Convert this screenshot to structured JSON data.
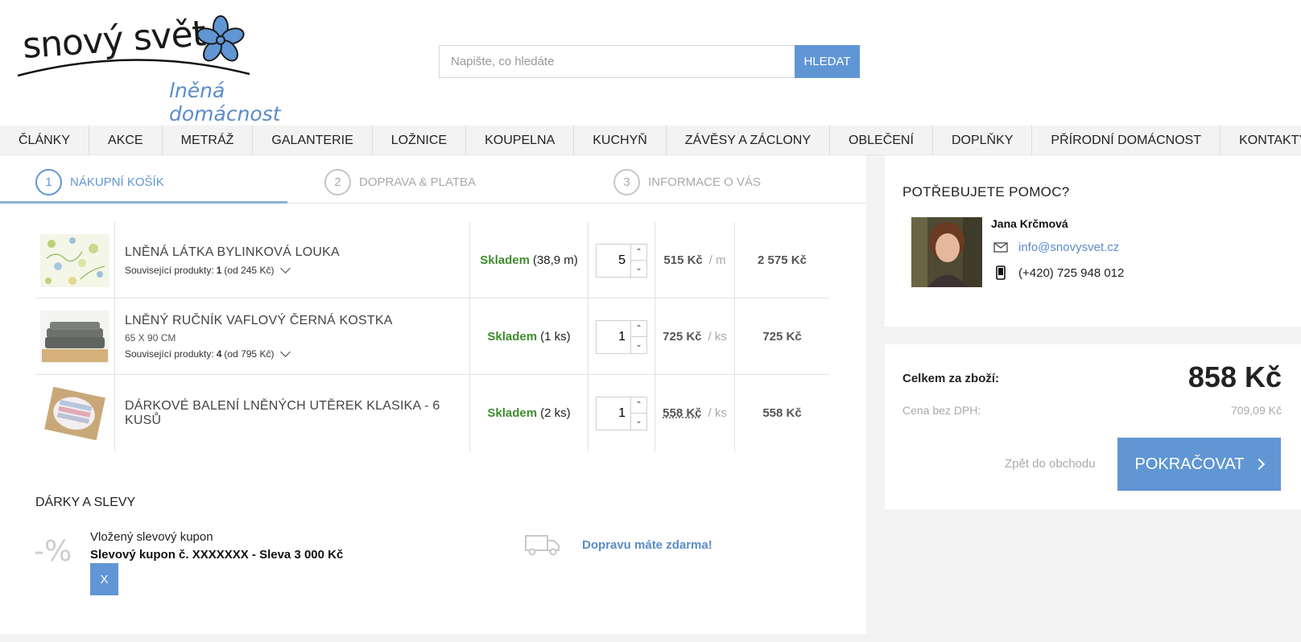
{
  "logo": {
    "main": "snový svět",
    "sub": "lněná domácnost"
  },
  "search": {
    "placeholder": "Napište, co hledáte",
    "button": "HLEDAT"
  },
  "nav": [
    "ČLÁNKY",
    "AKCE",
    "METRÁŽ",
    "GALANTERIE",
    "LOŽNICE",
    "KOUPELNA",
    "KUCHYŇ",
    "ZÁVĚSY A ZÁCLONY",
    "OBLEČENÍ",
    "DOPLŇKY",
    "PŘÍRODNÍ DOMÁCNOST",
    "KONTAKTY"
  ],
  "steps": [
    {
      "num": "1",
      "label": "NÁKUPNÍ KOŠÍK"
    },
    {
      "num": "2",
      "label": "DOPRAVA & PLATBA"
    },
    {
      "num": "3",
      "label": "INFORMACE O VÁS"
    }
  ],
  "cart": {
    "items": [
      {
        "name": "LNĚNÁ LÁTKA BYLINKOVÁ LOUKA",
        "sub": "",
        "related_label": "Související produkty:",
        "related_count": "1",
        "related_from": "(od 245 Kč)",
        "stock": "Skladem",
        "stock_qty": "(38,9 m)",
        "qty": "5",
        "unit_price": "515 Kč",
        "unit": "/ m",
        "total": "2 575 Kč"
      },
      {
        "name": "LNĚNÝ RUČNÍK VAFLOVÝ ČERNÁ KOSTKA",
        "sub": "65 X 90 CM",
        "related_label": "Související produkty:",
        "related_count": "4",
        "related_from": "(od 795 Kč)",
        "stock": "Skladem",
        "stock_qty": "(1 ks)",
        "qty": "1",
        "unit_price": "725 Kč",
        "unit": "/ ks",
        "total": "725 Kč"
      },
      {
        "name": "DÁRKOVÉ BALENÍ LNĚNÝCH UTĚREK KLASIKA - 6 KUSŮ",
        "sub": "",
        "related_label": "",
        "related_count": "",
        "related_from": "",
        "stock": "Skladem",
        "stock_qty": "(2 ks)",
        "qty": "1",
        "unit_price": "558 Kč",
        "unit": "/ ks",
        "total": "558 Kč"
      }
    ]
  },
  "gifts": {
    "title": "DÁRKY A SLEVY",
    "percent": "-%",
    "coupon_label": "Vložený slevový kupon",
    "coupon_value": "Slevový kupon č. XXXXXXX - Sleva 3 000 Kč",
    "remove": "X",
    "free_shipping": "Dopravu máte zdarma!"
  },
  "help": {
    "title": "POTŘEBUJETE POMOC?",
    "name": "Jana Krčmová",
    "email": "info@snovysvet.cz",
    "phone": "(+420) 725 948 012"
  },
  "summary": {
    "label": "Celkem za zboží:",
    "total": "858 Kč",
    "net_label": "Cena bez DPH:",
    "net": "709,09 Kč",
    "back": "Zpět do obchodu",
    "continue": "POKRAČOVAT"
  },
  "colors": {
    "accent": "#6096d4",
    "stock": "#3f8c2e",
    "link": "#5b8cc6"
  }
}
